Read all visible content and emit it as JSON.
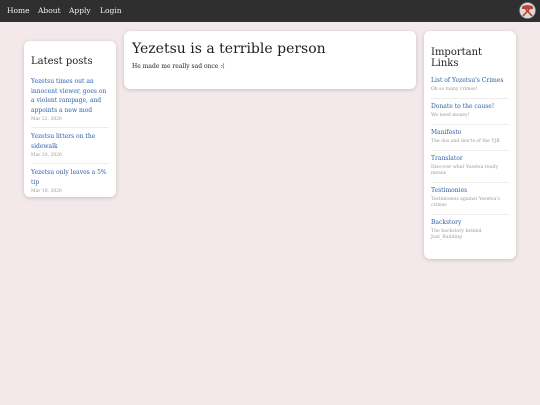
{
  "nav": {
    "items": [
      "Home",
      "About",
      "Apply",
      "Login"
    ],
    "logo_alt": "site-logo"
  },
  "sidebar_left": {
    "title": "Latest posts",
    "posts": [
      {
        "title": "Yezetsu times out an innocent viewer, goes on a violent rampage, and appoints a new mod",
        "date": "Mar 22, 2026"
      },
      {
        "title": "Yezetsu litters on the sidewalk",
        "date": "Mar 20, 2026"
      },
      {
        "title": "Yezetsu only leaves a 5% tip",
        "date": "Mar 18, 2026"
      }
    ]
  },
  "main": {
    "title": "Yezetsu is a terrible person",
    "body": "He made me really sad once :("
  },
  "sidebar_right": {
    "title": "Important Links",
    "links": [
      {
        "label": "List of Yezetsu's Crimes",
        "desc": "Oh so many crimes!"
      },
      {
        "label": "Donate to the cause!",
        "desc": "We need money!"
      },
      {
        "label": "Manifesto",
        "desc": "The dos and don'ts of the YJB"
      },
      {
        "label": "Translator",
        "desc": "Discover what Yezetsu really means"
      },
      {
        "label": "Testimonies",
        "desc": "Testimonies against Yezetsu's crimes"
      },
      {
        "label": "Backstory",
        "desc": "The backstory behind Just_Building"
      }
    ]
  },
  "colors": {
    "topbar": "#2f2f2f",
    "background": "#f3e9ea",
    "link": "#2b5fa8"
  }
}
